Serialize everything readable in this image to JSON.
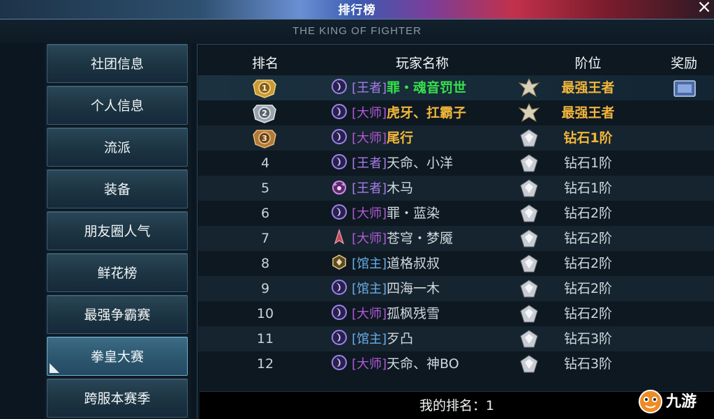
{
  "header": {
    "title": "排行榜",
    "subtitle": "THE KING OF FIGHTER",
    "close_icon": "×"
  },
  "sidebar": {
    "items": [
      {
        "label": "社团信息"
      },
      {
        "label": "个人信息"
      },
      {
        "label": "流派"
      },
      {
        "label": "装备"
      },
      {
        "label": "朋友圈人气"
      },
      {
        "label": "鲜花榜"
      },
      {
        "label": "最强争霸赛"
      },
      {
        "label": "拳皇大赛"
      },
      {
        "label": "跨服本赛季"
      }
    ],
    "active_index": 7
  },
  "table": {
    "columns": {
      "rank": "排名",
      "name": "玩家名称",
      "tier": "阶位",
      "reward": "奖励"
    },
    "rows": [
      {
        "rank": "1",
        "tag": "[王者]",
        "name": "罪・魂音罚世",
        "tier": "最强王者"
      },
      {
        "rank": "2",
        "tag": "[大师]",
        "name": "虎牙、扛霸子",
        "tier": "最强王者"
      },
      {
        "rank": "3",
        "tag": "[大师]",
        "name": "尾行",
        "tier": "钻石1阶"
      },
      {
        "rank": "4",
        "tag": "[王者]",
        "name": "天命、小洋",
        "tier": "钻石1阶"
      },
      {
        "rank": "5",
        "tag": "[王者]",
        "name": "木马",
        "tier": "钻石1阶"
      },
      {
        "rank": "6",
        "tag": "[大师]",
        "name": "罪・蓝染",
        "tier": "钻石2阶"
      },
      {
        "rank": "7",
        "tag": "[大师]",
        "name": "苍穹・梦魇",
        "tier": "钻石2阶"
      },
      {
        "rank": "8",
        "tag": "[馆主]",
        "name": "道格叔叔",
        "tier": "钻石2阶"
      },
      {
        "rank": "9",
        "tag": "[馆主]",
        "name": "四海一木",
        "tier": "钻石2阶"
      },
      {
        "rank": "10",
        "tag": "[大师]",
        "name": "孤枫残雪",
        "tier": "钻石2阶"
      },
      {
        "rank": "11",
        "tag": "[馆主]",
        "name": "歹凸",
        "tier": "钻石3阶"
      },
      {
        "rank": "12",
        "tag": "[大师]",
        "name": "天命、神BO",
        "tier": "钻石3阶"
      }
    ]
  },
  "footer": {
    "my_rank_label": "我的排名：1"
  },
  "watermark": {
    "text": "九游"
  },
  "colors": {
    "gold": "#f2b63a",
    "green": "#35e04a",
    "tag_king": "#a77ce8",
    "tag_master": "#b259d6",
    "tag_hall": "#6aaee8"
  }
}
